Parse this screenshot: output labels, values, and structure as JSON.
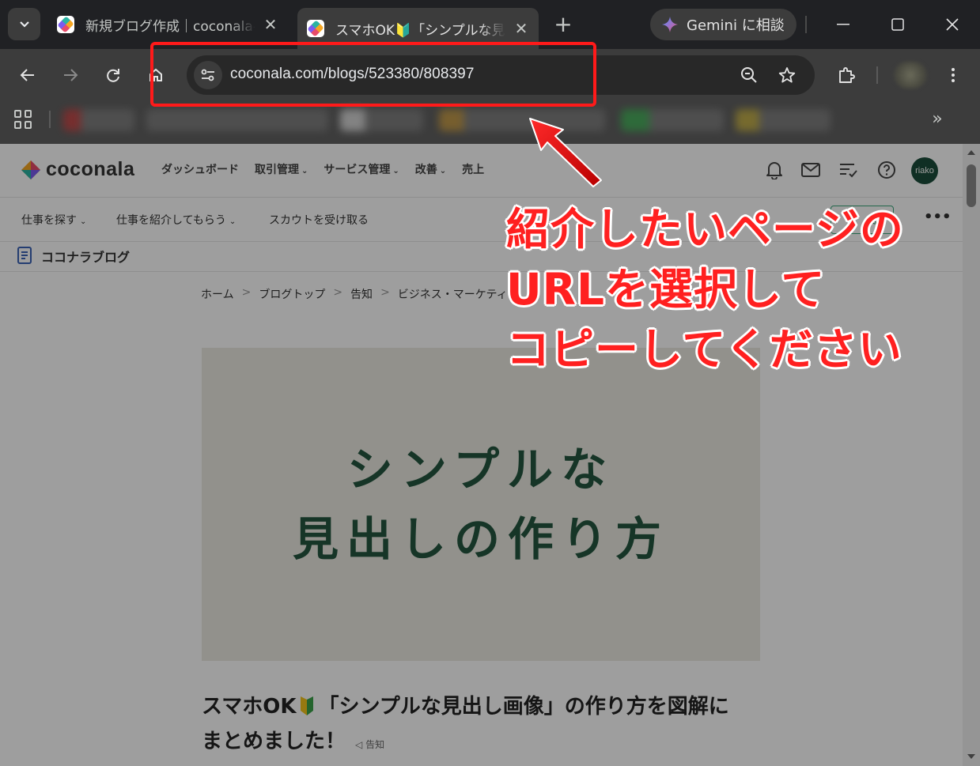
{
  "browser": {
    "tabs": [
      {
        "title": "新規ブログ作成｜coconala-",
        "active": false
      },
      {
        "title": "スマホOK🔰「シンプルな見出し",
        "active": true
      }
    ],
    "gemini_label": "Gemini に相談",
    "url": "coconala.com/blogs/523380/808397"
  },
  "site": {
    "logo": "coconala",
    "nav": [
      {
        "label": "ダッシュボード",
        "caret": false
      },
      {
        "label": "取引管理",
        "caret": true
      },
      {
        "label": "サービス管理",
        "caret": true
      },
      {
        "label": "改善",
        "caret": true
      },
      {
        "label": "売上",
        "caret": false
      }
    ],
    "avatar_label": "riako",
    "sub_nav": [
      {
        "label": "仕事を探す"
      },
      {
        "label": "仕事を紹介してもらう"
      },
      {
        "label": "スカウトを受け取る"
      }
    ],
    "sub_button": "る",
    "sub_more": "•••",
    "blog_title": "ココナラブログ"
  },
  "article": {
    "breadcrumb": [
      "ホーム",
      "ブログトップ",
      "告知",
      "ビジネス・マーケティン"
    ],
    "breadcrumb_sep": ">",
    "hero_lines": [
      "シンプルな",
      "見出しの作り方"
    ],
    "title_part1": "スマホOK",
    "title_part2": "「シンプルな見出し画像」の作り方を図解に",
    "title_part3": "まとめました！",
    "tag": "告知"
  },
  "annotation": {
    "lines": [
      "紹介したいページの",
      "URLを選択して",
      "コピーしてください"
    ],
    "color": "#ff2020"
  },
  "colors": {
    "accent_green": "#24563f",
    "highlight_red": "#ff1a1a"
  }
}
